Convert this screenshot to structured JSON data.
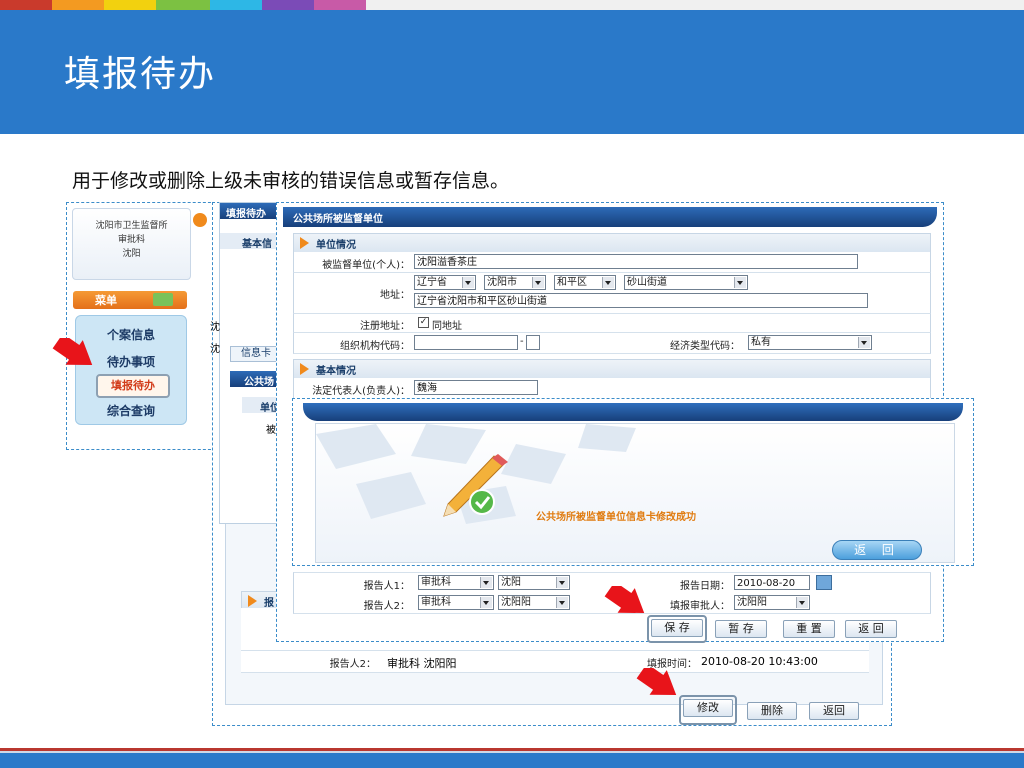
{
  "slide": {
    "title": "填报待办",
    "subtitle": "用于修改或删除上级未审核的错误信息或暂存信息。",
    "stripe_colors": [
      "#c93a2c",
      "#f39a21",
      "#f2d10f",
      "#7cc142",
      "#2db7e6",
      "#7b4bb7",
      "#c85aa7"
    ]
  },
  "left_menu": {
    "org_line1": "沈阳市卫生监督所",
    "org_line2": "审批科",
    "org_line3": "沈阳",
    "menu_label": "菜单",
    "items": [
      "个案信息",
      "待办事项",
      "填报待办",
      "综合查询"
    ]
  },
  "mid_form": {
    "title": "填报待办",
    "section1": "基本信",
    "tab_label": "信息卡",
    "subtitle2": "公共场",
    "section2": "单位",
    "row_label": "被",
    "text_snippets": [
      "沈",
      "沈"
    ]
  },
  "back_form": {
    "reporter2_label": "报告人2：",
    "reporter2_value": "审批科  沈阳阳",
    "fill_time_label": "填报时间：",
    "fill_time_value": "2010-08-20 10:43:00",
    "section_label": "报",
    "buttons": {
      "edit": "修改",
      "delete": "删除",
      "back": "返回"
    }
  },
  "front_form": {
    "title": "公共场所被监督单位",
    "section_unit": "单位情况",
    "unit_label": "被监督单位(个人)：",
    "unit_value": "沈阳溢香茶庄",
    "address_label": "地址：",
    "province": "辽宁省",
    "city": "沈阳市",
    "district": "和平区",
    "street": "砂山街道",
    "address_full": "辽宁省沈阳市和平区砂山街道",
    "reg_address_label": "注册地址：",
    "same_address_label": "同地址",
    "org_code_label": "组织机构代码：",
    "org_code_dash": "-",
    "econ_type_label": "经济类型代码：",
    "econ_type_value": "私有",
    "section_basic": "基本情况",
    "legal_rep_label": "法定代表人(负责人)：",
    "legal_rep_value": "魏海",
    "reporter1_label": "报告人1：",
    "reporter1_dept": "审批科",
    "reporter1_name": "沈阳",
    "report_date_label": "报告日期：",
    "report_date_value": "2010-08-20",
    "reporter2_label": "报告人2：",
    "reporter2_dept": "审批科",
    "reporter2_name": "沈阳阳",
    "approver_label": "填报审批人：",
    "approver_value": "沈阳阳",
    "buttons": {
      "save": "保  存",
      "draft": "暂  存",
      "reset": "重  置",
      "back": "返  回"
    }
  },
  "dialog": {
    "message": "公共场所被监督单位信息卡修改成功",
    "button": "返 回"
  }
}
